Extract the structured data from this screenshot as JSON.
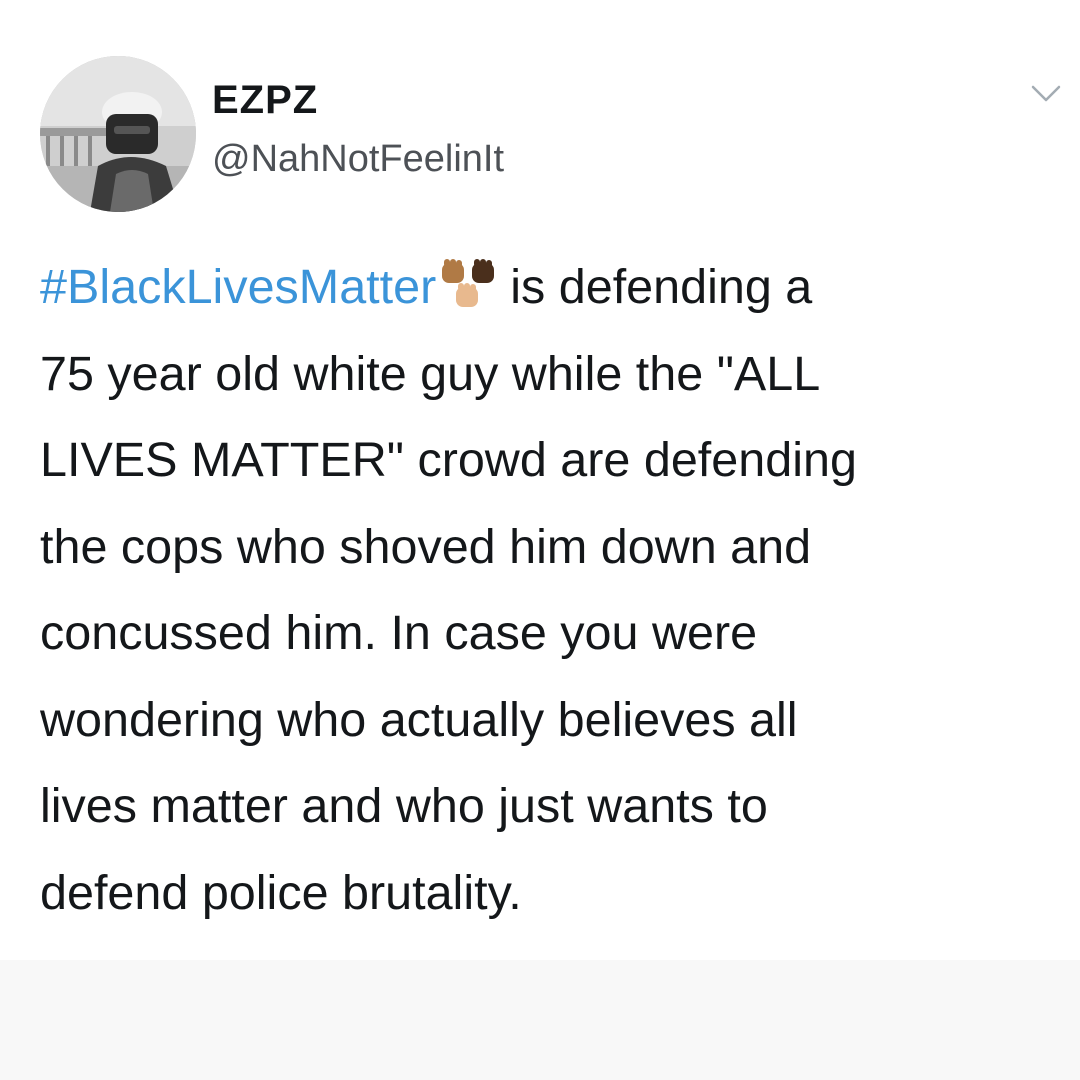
{
  "user": {
    "display_name": "EZPZ",
    "handle": "@NahNotFeelinIt",
    "avatar_icon": "profile-photo-avatar"
  },
  "menu": {
    "icon": "chevron-down-icon"
  },
  "tweet": {
    "hashtag": "#BlackLivesMatter",
    "emoji_icon": "raised-fists-emoji-icon",
    "lines": [
      "is defending a",
      "75 year old white guy while the \"ALL",
      "LIVES MATTER\" crowd are defending",
      "the cops who shoved him down and",
      "concussed him. In case you were",
      "wondering who actually believes all",
      "lives matter and who just wants to",
      "defend police brutality."
    ]
  },
  "colors": {
    "hashtag": "#3b94d9",
    "text": "#14171a",
    "handle": "#4d5156",
    "background": "#ffffff"
  }
}
